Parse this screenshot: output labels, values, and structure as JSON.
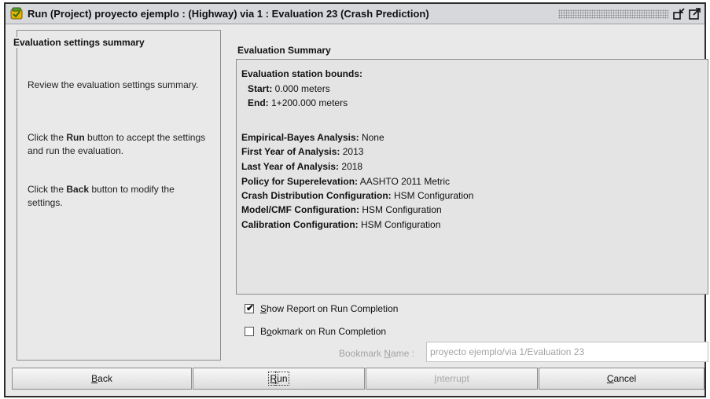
{
  "window": {
    "title": "Run (Project) proyecto ejemplo : (Highway) via 1 : Evaluation 23 (Crash Prediction)"
  },
  "left_panel": {
    "heading": "Evaluation settings summary",
    "para1": "Review the evaluation settings summary.",
    "para2_pre": "Click the ",
    "para2_bold": "Run",
    "para2_post": " button to accept the settings and run the evaluation.",
    "para3_pre": "Click the ",
    "para3_bold": "Back",
    "para3_post": " button to modify the settings."
  },
  "summary": {
    "heading": "Evaluation Summary",
    "bounds_label": "Evaluation station bounds:",
    "start_label": "Start:",
    "start_value": " 0.000 meters",
    "end_label": "End:",
    "end_value": " 1+200.000 meters",
    "rows": [
      {
        "label": "Empirical-Bayes Analysis:",
        "value": " None"
      },
      {
        "label": "First Year of Analysis:",
        "value": " 2013"
      },
      {
        "label": "Last Year of Analysis:",
        "value": " 2018"
      },
      {
        "label": "Policy for Superelevation:",
        "value": " AASHTO 2011 Metric"
      },
      {
        "label": "Crash Distribution Configuration:",
        "value": " HSM Configuration"
      },
      {
        "label": "Model/CMF Configuration:",
        "value": " HSM Configuration"
      },
      {
        "label": "Calibration Configuration:",
        "value": " HSM Configuration"
      }
    ]
  },
  "options": {
    "show_report": {
      "label_mnemonic": "S",
      "label_rest": "how Report on Run Completion",
      "checked": true
    },
    "bookmark": {
      "label_pre": "B",
      "label_mnemonic": "o",
      "label_rest": "okmark on Run Completion",
      "checked": false
    },
    "bookmark_name_pre": "Bookmark ",
    "bookmark_name_mnemonic": "N",
    "bookmark_name_post": "ame :",
    "bookmark_name_value": "proyecto ejemplo/via 1/Evaluation 23"
  },
  "buttons": {
    "back": {
      "mnemonic": "B",
      "rest": "ack"
    },
    "run": {
      "mnemonic": "R",
      "rest": "un"
    },
    "interrupt": {
      "mnemonic": "I",
      "rest": "nterrupt"
    },
    "cancel": {
      "mnemonic": "C",
      "rest": "ancel"
    }
  },
  "colors": {
    "window_bg": "#e9e9e9",
    "disabled_text": "#a8a8a8"
  },
  "icons": [
    "app-icon",
    "minimize-icon",
    "maximize-icon",
    "checkmark-icon"
  ]
}
